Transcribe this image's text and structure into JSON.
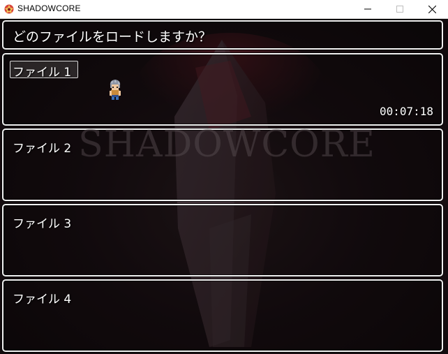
{
  "window": {
    "title": "SHADOWCORE",
    "icon": "app-emblem-icon",
    "controls": [
      "minimize-icon",
      "maximize-icon",
      "close-icon"
    ]
  },
  "background": {
    "logo_text": "SHADOWCORE"
  },
  "help": {
    "text": "どのファイルをロードしますか？"
  },
  "slots": [
    {
      "label": "ファイル 1",
      "playtime": "00:07:18",
      "selected": true,
      "has_character": true
    },
    {
      "label": "ファイル 2",
      "playtime": "",
      "selected": false,
      "has_character": false
    },
    {
      "label": "ファイル 3",
      "playtime": "",
      "selected": false,
      "has_character": false
    },
    {
      "label": "ファイル 4",
      "playtime": "",
      "selected": false,
      "has_character": false
    }
  ],
  "colors": {
    "panel_border": "#f0f0f0",
    "text": "#ffffff",
    "background": "#1b1014"
  }
}
